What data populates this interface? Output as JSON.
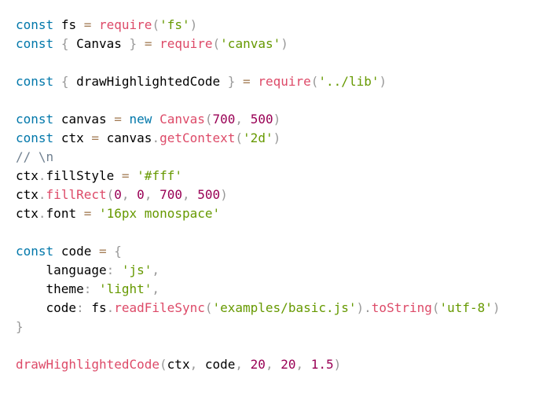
{
  "colors": {
    "background": "#ffffff",
    "keyword": "#0077aa",
    "function": "#dd4a68",
    "string": "#669900",
    "number": "#990055",
    "operator": "#a67f59",
    "punctuation": "#999999",
    "comment": "#708090",
    "identifier": "#000000"
  },
  "code_lines": [
    [
      [
        "keyword",
        "const"
      ],
      [
        "text",
        " "
      ],
      [
        "ident",
        "fs"
      ],
      [
        "text",
        " "
      ],
      [
        "operator",
        "="
      ],
      [
        "text",
        " "
      ],
      [
        "func",
        "require"
      ],
      [
        "punct",
        "("
      ],
      [
        "string",
        "'fs'"
      ],
      [
        "punct",
        ")"
      ]
    ],
    [
      [
        "keyword",
        "const"
      ],
      [
        "text",
        " "
      ],
      [
        "punct",
        "{"
      ],
      [
        "text",
        " "
      ],
      [
        "ident",
        "Canvas"
      ],
      [
        "text",
        " "
      ],
      [
        "punct",
        "}"
      ],
      [
        "text",
        " "
      ],
      [
        "operator",
        "="
      ],
      [
        "text",
        " "
      ],
      [
        "func",
        "require"
      ],
      [
        "punct",
        "("
      ],
      [
        "string",
        "'canvas'"
      ],
      [
        "punct",
        ")"
      ]
    ],
    [],
    [
      [
        "keyword",
        "const"
      ],
      [
        "text",
        " "
      ],
      [
        "punct",
        "{"
      ],
      [
        "text",
        " "
      ],
      [
        "ident",
        "drawHighlightedCode"
      ],
      [
        "text",
        " "
      ],
      [
        "punct",
        "}"
      ],
      [
        "text",
        " "
      ],
      [
        "operator",
        "="
      ],
      [
        "text",
        " "
      ],
      [
        "func",
        "require"
      ],
      [
        "punct",
        "("
      ],
      [
        "string",
        "'../lib'"
      ],
      [
        "punct",
        ")"
      ]
    ],
    [],
    [
      [
        "keyword",
        "const"
      ],
      [
        "text",
        " "
      ],
      [
        "ident",
        "canvas"
      ],
      [
        "text",
        " "
      ],
      [
        "operator",
        "="
      ],
      [
        "text",
        " "
      ],
      [
        "keyword",
        "new"
      ],
      [
        "text",
        " "
      ],
      [
        "func",
        "Canvas"
      ],
      [
        "punct",
        "("
      ],
      [
        "number",
        "700"
      ],
      [
        "punct",
        ","
      ],
      [
        "text",
        " "
      ],
      [
        "number",
        "500"
      ],
      [
        "punct",
        ")"
      ]
    ],
    [
      [
        "keyword",
        "const"
      ],
      [
        "text",
        " "
      ],
      [
        "ident",
        "ctx"
      ],
      [
        "text",
        " "
      ],
      [
        "operator",
        "="
      ],
      [
        "text",
        " "
      ],
      [
        "ident",
        "canvas"
      ],
      [
        "punct",
        "."
      ],
      [
        "func",
        "getContext"
      ],
      [
        "punct",
        "("
      ],
      [
        "string",
        "'2d'"
      ],
      [
        "punct",
        ")"
      ]
    ],
    [
      [
        "comment",
        "// \\n"
      ]
    ],
    [
      [
        "ident",
        "ctx"
      ],
      [
        "punct",
        "."
      ],
      [
        "ident",
        "fillStyle"
      ],
      [
        "text",
        " "
      ],
      [
        "operator",
        "="
      ],
      [
        "text",
        " "
      ],
      [
        "string",
        "'#fff'"
      ]
    ],
    [
      [
        "ident",
        "ctx"
      ],
      [
        "punct",
        "."
      ],
      [
        "func",
        "fillRect"
      ],
      [
        "punct",
        "("
      ],
      [
        "number",
        "0"
      ],
      [
        "punct",
        ","
      ],
      [
        "text",
        " "
      ],
      [
        "number",
        "0"
      ],
      [
        "punct",
        ","
      ],
      [
        "text",
        " "
      ],
      [
        "number",
        "700"
      ],
      [
        "punct",
        ","
      ],
      [
        "text",
        " "
      ],
      [
        "number",
        "500"
      ],
      [
        "punct",
        ")"
      ]
    ],
    [
      [
        "ident",
        "ctx"
      ],
      [
        "punct",
        "."
      ],
      [
        "ident",
        "font"
      ],
      [
        "text",
        " "
      ],
      [
        "operator",
        "="
      ],
      [
        "text",
        " "
      ],
      [
        "string",
        "'16px monospace'"
      ]
    ],
    [],
    [
      [
        "keyword",
        "const"
      ],
      [
        "text",
        " "
      ],
      [
        "ident",
        "code"
      ],
      [
        "text",
        " "
      ],
      [
        "operator",
        "="
      ],
      [
        "text",
        " "
      ],
      [
        "punct",
        "{"
      ]
    ],
    [
      [
        "text",
        "    "
      ],
      [
        "ident",
        "language"
      ],
      [
        "punct",
        ":"
      ],
      [
        "text",
        " "
      ],
      [
        "string",
        "'js'"
      ],
      [
        "punct",
        ","
      ]
    ],
    [
      [
        "text",
        "    "
      ],
      [
        "ident",
        "theme"
      ],
      [
        "punct",
        ":"
      ],
      [
        "text",
        " "
      ],
      [
        "string",
        "'light'"
      ],
      [
        "punct",
        ","
      ]
    ],
    [
      [
        "text",
        "    "
      ],
      [
        "ident",
        "code"
      ],
      [
        "punct",
        ":"
      ],
      [
        "text",
        " "
      ],
      [
        "ident",
        "fs"
      ],
      [
        "punct",
        "."
      ],
      [
        "func",
        "readFileSync"
      ],
      [
        "punct",
        "("
      ],
      [
        "string",
        "'examples/basic.js'"
      ],
      [
        "punct",
        ")"
      ],
      [
        "punct",
        "."
      ],
      [
        "func",
        "toString"
      ],
      [
        "punct",
        "("
      ],
      [
        "string",
        "'utf-8'"
      ],
      [
        "punct",
        ")"
      ]
    ],
    [
      [
        "punct",
        "}"
      ]
    ],
    [],
    [
      [
        "func",
        "drawHighlightedCode"
      ],
      [
        "punct",
        "("
      ],
      [
        "ident",
        "ctx"
      ],
      [
        "punct",
        ","
      ],
      [
        "text",
        " "
      ],
      [
        "ident",
        "code"
      ],
      [
        "punct",
        ","
      ],
      [
        "text",
        " "
      ],
      [
        "number",
        "20"
      ],
      [
        "punct",
        ","
      ],
      [
        "text",
        " "
      ],
      [
        "number",
        "20"
      ],
      [
        "punct",
        ","
      ],
      [
        "text",
        " "
      ],
      [
        "number",
        "1.5"
      ],
      [
        "punct",
        ")"
      ]
    ]
  ]
}
